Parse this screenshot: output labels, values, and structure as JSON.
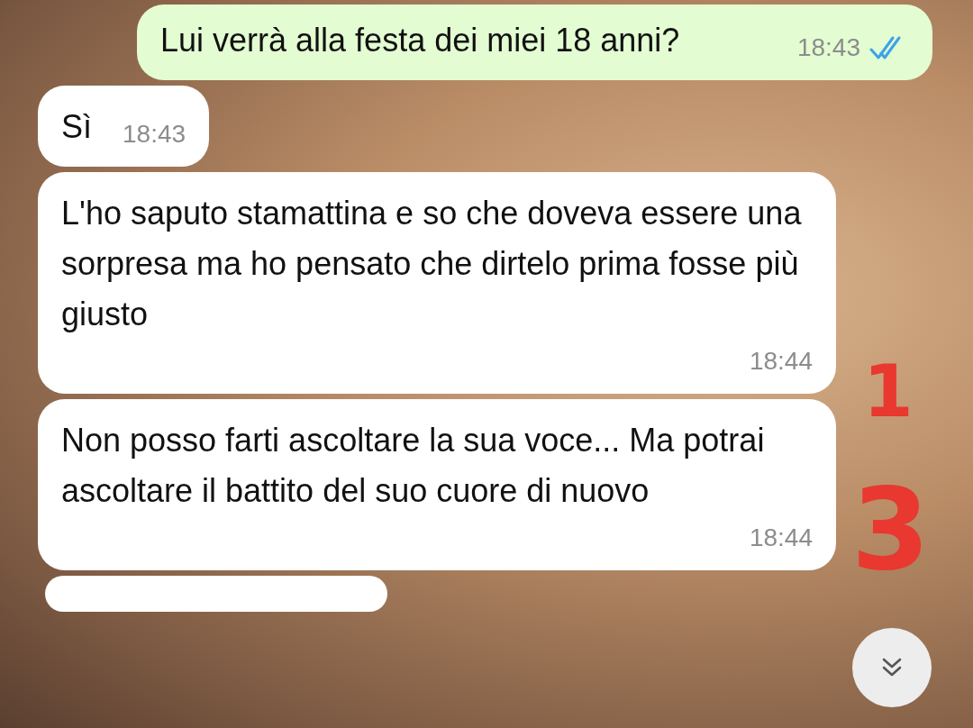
{
  "messages": [
    {
      "kind": "outgoing",
      "text": "Lui verrà alla festa dei miei 18 anni?",
      "time": "18:43",
      "read": true
    },
    {
      "kind": "incoming",
      "text": "Sì",
      "time": "18:43"
    },
    {
      "kind": "incoming",
      "text": "L'ho saputo stamattina e so che doveva essere una sorpresa ma ho pensato che dirtelo prima fosse più giusto",
      "time": "18:44"
    },
    {
      "kind": "incoming",
      "text": "Non posso farti ascoltare la sua voce... Ma potrai ascoltare il battito del suo cuore di nuovo",
      "time": "18:44"
    }
  ],
  "annotations": [
    {
      "text": "1"
    },
    {
      "text": "3"
    }
  ]
}
